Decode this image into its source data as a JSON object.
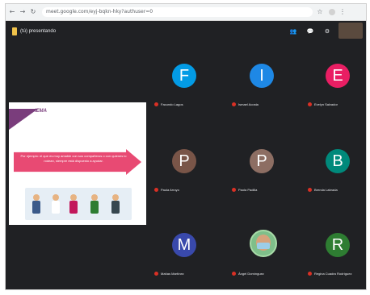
{
  "browser": {
    "url": "meet.google.com/eyj-bqkn-hky?authuser=0"
  },
  "meeting": {
    "presenter_label": "(tú) presentando",
    "icons": [
      "people-icon",
      "chat-icon",
      "activities-icon"
    ]
  },
  "slide": {
    "tag": "IEMA",
    "caption": "Por ejemplo: el que es muy amable con sus compañeros o con quienes lo rodean, siempre está dispuesto a ayudar."
  },
  "participants": [
    {
      "initial": "F",
      "name": "Facundo Lagos",
      "color": "#039be5"
    },
    {
      "initial": "I",
      "name": "Ismael Acosta",
      "color": "#1e88e5"
    },
    {
      "initial": "E",
      "name": "Evelyn Salvador",
      "color": "#e91e63"
    },
    {
      "initial": "P",
      "name": "Paula Arroyo",
      "color": "#795548"
    },
    {
      "initial": "P",
      "name": "Paola Padilla",
      "color": "#8d6e63"
    },
    {
      "initial": "B",
      "name": "Brenda Labrada",
      "color": "#00897b"
    },
    {
      "initial": "M",
      "name": "Matías Martínez",
      "color": "#3949ab"
    },
    {
      "initial": "",
      "name": "Ángel Domínguez",
      "color": "#7fbf8a"
    },
    {
      "initial": "R",
      "name": "Regina Cuadra Rodríguez",
      "color": "#2e7d32"
    }
  ]
}
